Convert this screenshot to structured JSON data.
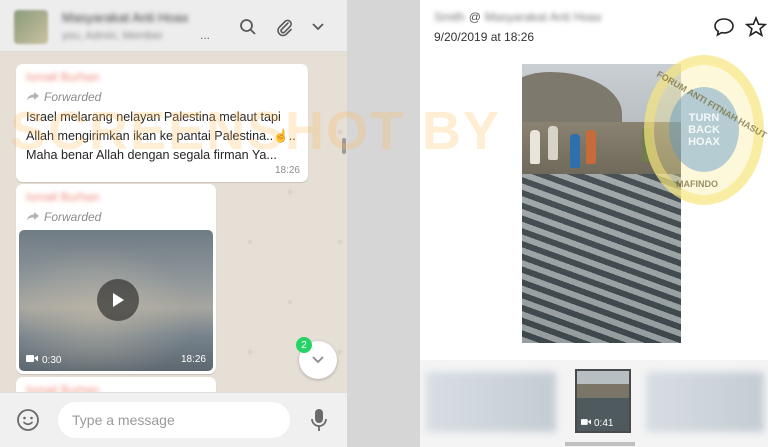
{
  "chat": {
    "header": {
      "contact_name": "Masyarakat Anti Hoax",
      "contact_sub": "you, Admin, Member",
      "ellipsis": "..."
    },
    "messages": [
      {
        "sender": "Ismail Burhan",
        "forwarded_label": "Forwarded",
        "text": "Israel melarang nelayan Palestina melaut tapi Allah mengirimkan ikan ke pantai Palestina..☝..  Maha benar Allah dengan segala firman Ya...",
        "time": "18:26"
      },
      {
        "sender": "Ismail Burhan",
        "forwarded_label": "Forwarded",
        "video_duration": "0:30",
        "time": "18:26"
      },
      {
        "sender": "Ismail Burhan"
      }
    ],
    "unread_count": "2",
    "composer": {
      "placeholder": "Type a message"
    }
  },
  "post": {
    "user_name": "Smith",
    "at_symbol": "@",
    "group_name": "Masyarakat Anti Hoax",
    "date": "9/20/2019 at 18:26",
    "thumbnail_duration": "0:41",
    "stamp_text_lines": [
      "TURN",
      "BACK",
      "HOAX"
    ],
    "stamp_ring_top": "FORUM ANTI FITNAH HASUT",
    "stamp_ring_bottom": "MAFINDO"
  },
  "watermark": "SCREENSHOT BY",
  "colors": {
    "chat_bg": "#e6dfd6",
    "sender_color": "#f08a7a",
    "unread_badge": "#25d366",
    "watermark": "#ffba5a"
  }
}
